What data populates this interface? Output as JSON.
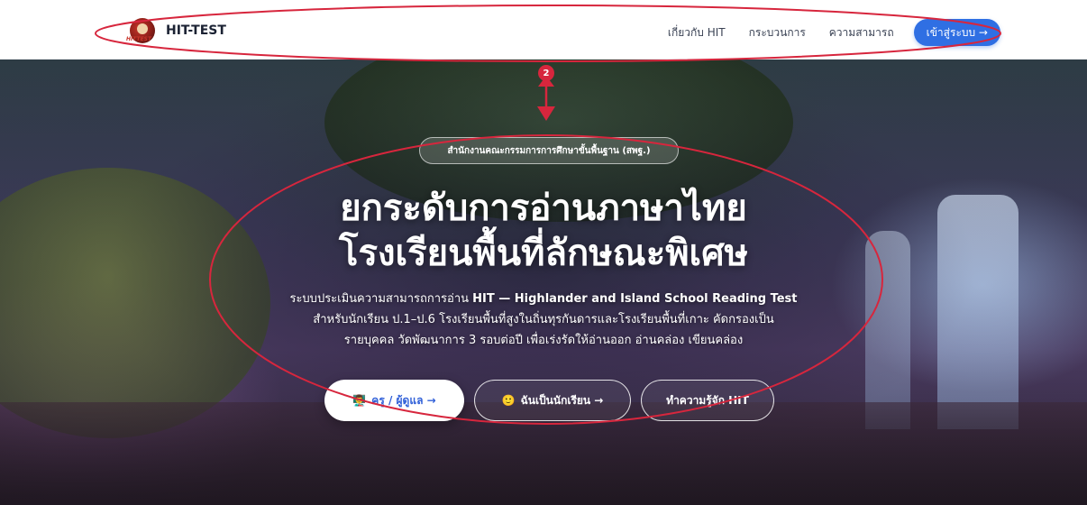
{
  "brand": {
    "name": "HIT-TEST",
    "logo_tag": "HITTEST",
    "logo_icon": "hit-logo-icon"
  },
  "nav": {
    "links": [
      "เกี่ยวกับ HIT",
      "กระบวนการ",
      "ความสามารถ"
    ],
    "login_label": "เข้าสู่ระบบ →"
  },
  "hero": {
    "badge": "สำนักงานคณะกรรมการการศึกษาขั้นพื้นฐาน (สพฐ.)",
    "headline_line1": "ยกระดับการอ่านภาษาไทย",
    "headline_line2": "โรงเรียนพื้นที่ลักษณะพิเศษ",
    "desc_prefix": "ระบบประเมินความสามารถการอ่าน ",
    "desc_bold": "HIT — Highlander and Island School Reading Test",
    "desc_line2": "สำหรับนักเรียน ป.1–ป.6 โรงเรียนพื้นที่สูงในถิ่นทุรกันดารและโรงเรียนพื้นที่เกาะ คัดกรองเป็น",
    "desc_line3": "รายบุคคล วัดพัฒนาการ 3 รอบต่อปี เพื่อเร่งรัดให้อ่านออก อ่านคล่อง เขียนคล่อง"
  },
  "cta": {
    "teacher_label": "ครู / ผู้ดูแล →",
    "teacher_icon": "👨‍🏫",
    "student_label": "ฉันเป็นนักเรียน →",
    "student_icon": "🙂",
    "about_label": "ทำความรู้จัก HIT"
  },
  "annotation": {
    "marker_label": "2",
    "color": "#d7263d"
  },
  "colors": {
    "accent": "#2f6fe3",
    "annotation": "#d7263d"
  }
}
